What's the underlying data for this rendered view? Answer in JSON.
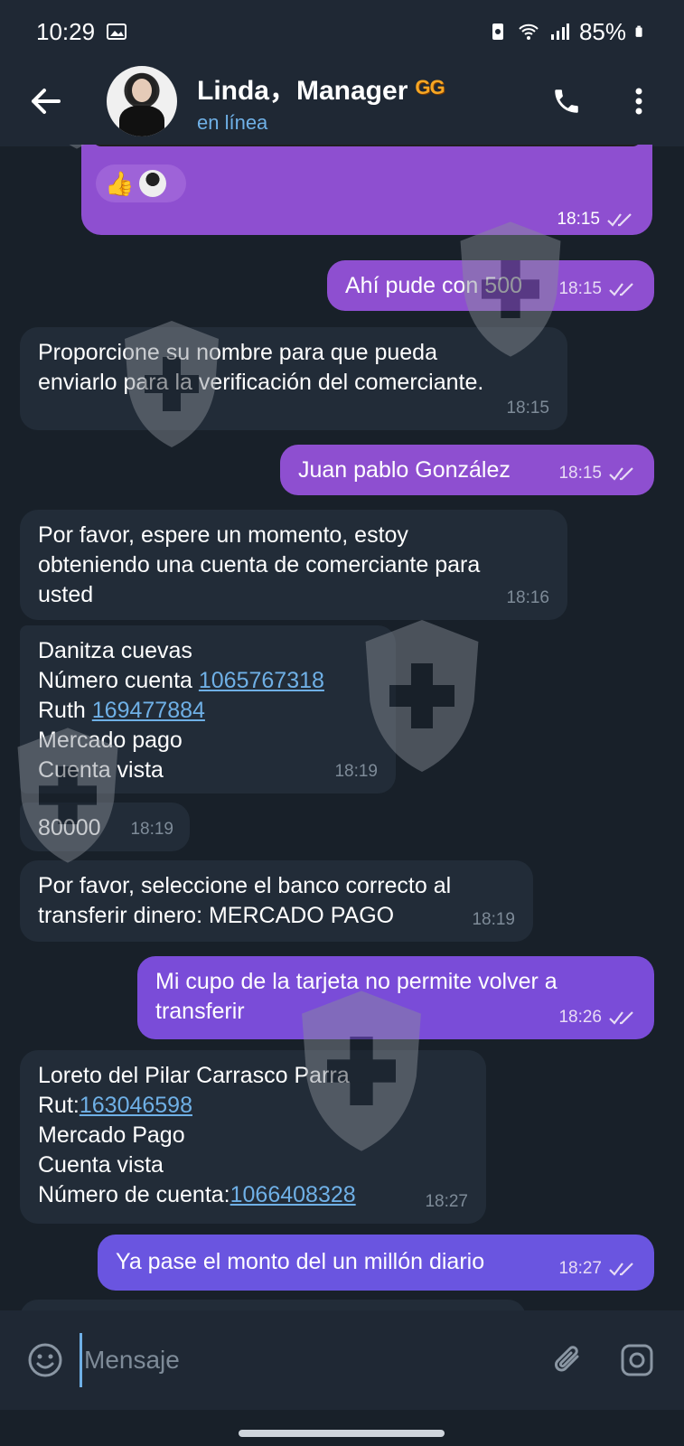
{
  "status_bar": {
    "time": "10:29",
    "battery": "85%"
  },
  "header": {
    "title": "Linda，Manager",
    "badge": "GG",
    "status": "en línea"
  },
  "messages": [
    {
      "id": "m0",
      "dir": "out",
      "time": "18:15",
      "reaction": "👍"
    },
    {
      "id": "m1",
      "dir": "out",
      "text": "Ahí pude con 500",
      "time": "18:15"
    },
    {
      "id": "m2",
      "dir": "in",
      "lines": [
        "Proporcione su nombre para que pueda",
        "enviarlo para la verificación del comerciante."
      ],
      "time": "18:15"
    },
    {
      "id": "m3",
      "dir": "out",
      "text": "Juan  pablo González",
      "time": "18:15"
    },
    {
      "id": "m4",
      "dir": "in",
      "lines": [
        "Por favor, espere un momento, estoy",
        "obteniendo una cuenta de comerciante para",
        "usted"
      ],
      "time": "18:16"
    },
    {
      "id": "m5",
      "dir": "in",
      "line1": "Danitza cuevas",
      "line2_label": "Número cuenta ",
      "line2_link": "1065767318",
      "line3_label": "Ruth ",
      "line3_link": "169477884",
      "line4": "Mercado pago",
      "line5": "Cuenta vista",
      "time": "18:19"
    },
    {
      "id": "m6",
      "dir": "in",
      "text": "80000",
      "time": "18:19"
    },
    {
      "id": "m7",
      "dir": "in",
      "lines": [
        "Por favor, seleccione el banco correcto al",
        "transferir dinero: MERCADO PAGO"
      ],
      "time": "18:19"
    },
    {
      "id": "m8",
      "dir": "out",
      "lines": [
        "Mi cupo de la tarjeta  no permite  volver a",
        "transferir"
      ],
      "time": "18:26"
    },
    {
      "id": "m9",
      "dir": "in",
      "line1": "Loreto del Pilar Carrasco Parra",
      "line2_label": "Rut:",
      "line2_link": "163046598",
      "line3": "Mercado Pago",
      "line4": "Cuenta vista",
      "line5_label": "Número de cuenta:",
      "line5_link": "1066408328",
      "time": "18:27"
    },
    {
      "id": "m10",
      "dir": "out",
      "text": "Ya pase el monto del un millón  diario",
      "time": "18:27"
    }
  ],
  "input": {
    "placeholder": "Mensaje"
  },
  "colors": {
    "incoming": "#222c38",
    "outgoing": "#8e4fd0",
    "link": "#6fb0e6",
    "background": "#182029"
  }
}
